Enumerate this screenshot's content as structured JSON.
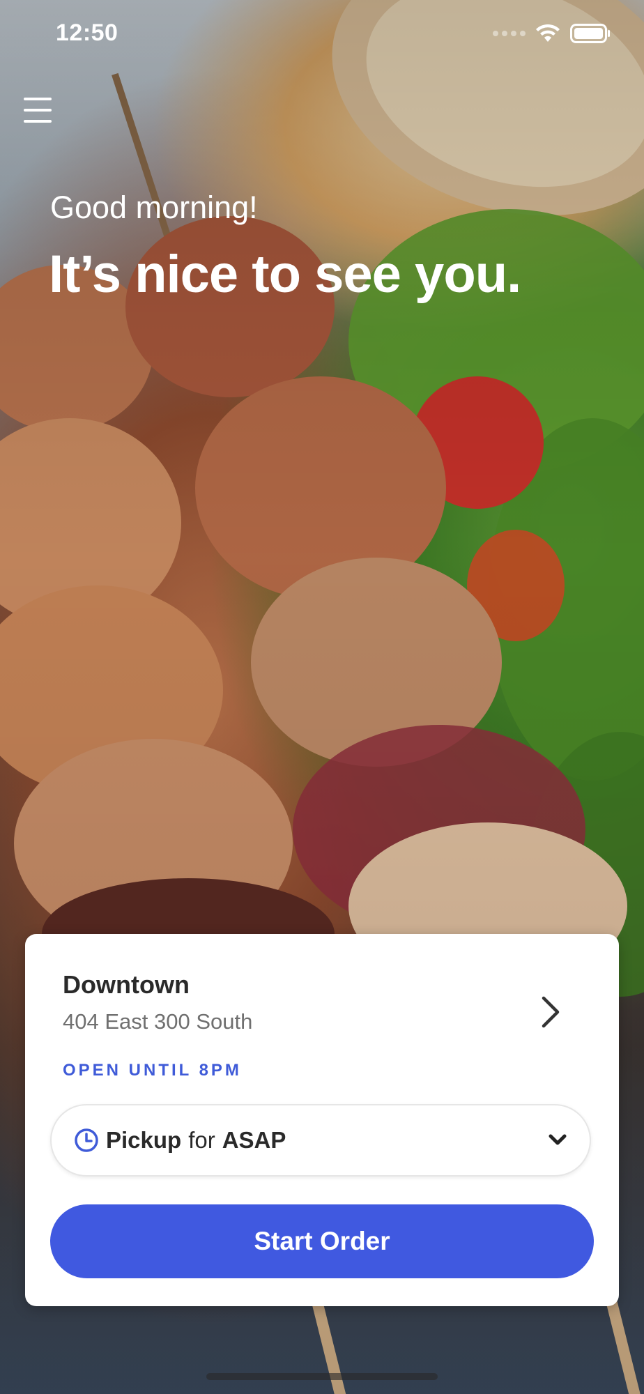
{
  "status_bar": {
    "time": "12:50"
  },
  "greeting": {
    "subtitle": "Good morning!",
    "headline": "It’s nice to see you."
  },
  "location_card": {
    "name": "Downtown",
    "address": "404 East 300 South",
    "status": "OPEN UNTIL 8PM",
    "order_mode": {
      "mode": "Pickup",
      "connector": "for",
      "time": "ASAP"
    },
    "start_button_label": "Start Order"
  },
  "colors": {
    "accent": "#4059e0",
    "status_text": "#3f5bd8",
    "card_background": "#ffffff"
  },
  "icons": {
    "menu": "hamburger-menu-icon",
    "location_chevron": "chevron-right-icon",
    "pickup_time": "clock-icon",
    "dropdown": "chevron-down-icon"
  }
}
